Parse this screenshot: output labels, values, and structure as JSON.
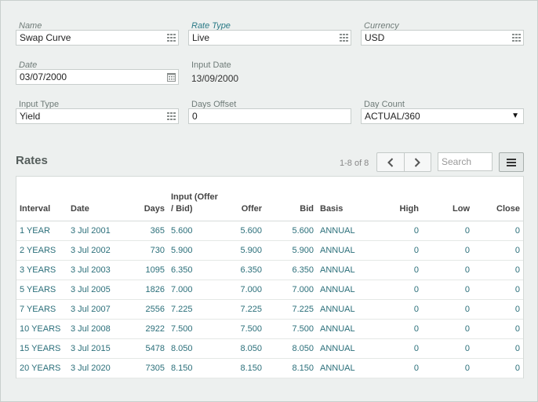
{
  "form": {
    "name": {
      "label": "Name",
      "value": "Swap Curve"
    },
    "rate_type": {
      "label": "Rate Type",
      "value": "Live"
    },
    "currency": {
      "label": "Currency",
      "value": "USD"
    },
    "date": {
      "label": "Date",
      "value": "03/07/2000"
    },
    "input_date": {
      "label": "Input Date",
      "value": "13/09/2000"
    },
    "input_type": {
      "label": "Input Type",
      "value": "Yield"
    },
    "days_offset": {
      "label": "Days Offset",
      "value": "0"
    },
    "day_count": {
      "label": "Day Count",
      "value": "ACTUAL/360"
    }
  },
  "rates": {
    "title": "Rates",
    "pager": "1-8 of 8",
    "search_placeholder": "Search",
    "icons": {
      "prev": "chevron-left-icon",
      "next": "chevron-right-icon",
      "menu": "hamburger-menu-icon"
    },
    "columns": [
      "Interval",
      "Date",
      "Days",
      "Input (Offer / Bid)",
      "Offer",
      "Bid",
      "Basis",
      "High",
      "Low",
      "Close"
    ],
    "rows": [
      [
        "1 YEAR",
        "3 Jul 2001",
        "365",
        "5.600",
        "5.600",
        "5.600",
        "ANNUAL",
        "0",
        "0",
        "0"
      ],
      [
        "2 YEARS",
        "3 Jul 2002",
        "730",
        "5.900",
        "5.900",
        "5.900",
        "ANNUAL",
        "0",
        "0",
        "0"
      ],
      [
        "3 YEARS",
        "3 Jul 2003",
        "1095",
        "6.350",
        "6.350",
        "6.350",
        "ANNUAL",
        "0",
        "0",
        "0"
      ],
      [
        "5 YEARS",
        "3 Jul 2005",
        "1826",
        "7.000",
        "7.000",
        "7.000",
        "ANNUAL",
        "0",
        "0",
        "0"
      ],
      [
        "7 YEARS",
        "3 Jul 2007",
        "2556",
        "7.225",
        "7.225",
        "7.225",
        "ANNUAL",
        "0",
        "0",
        "0"
      ],
      [
        "10 YEARS",
        "3 Jul 2008",
        "2922",
        "7.500",
        "7.500",
        "7.500",
        "ANNUAL",
        "0",
        "0",
        "0"
      ],
      [
        "15 YEARS",
        "3 Jul 2015",
        "5478",
        "8.050",
        "8.050",
        "8.050",
        "ANNUAL",
        "0",
        "0",
        "0"
      ],
      [
        "20 YEARS",
        "3 Jul 2020",
        "7305",
        "8.150",
        "8.150",
        "8.150",
        "ANNUAL",
        "0",
        "0",
        "0"
      ]
    ]
  },
  "colors": {
    "panel": "#edf0ef",
    "link": "#2b6f7a",
    "label": "#6f7b78"
  }
}
